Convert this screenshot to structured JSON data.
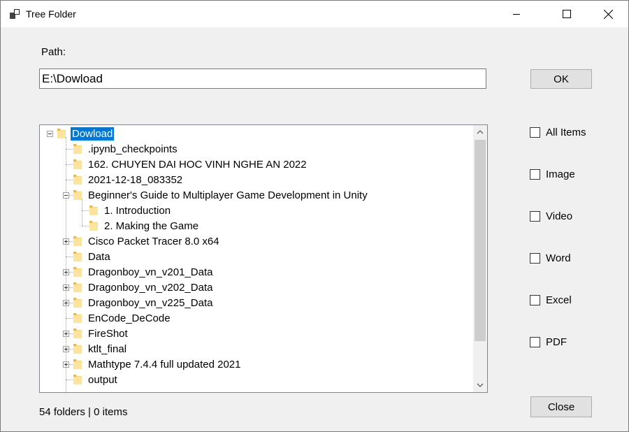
{
  "window": {
    "title": "Tree Folder",
    "controls": [
      "minimize-icon",
      "maximize-icon",
      "close-icon"
    ]
  },
  "path": {
    "label": "Path:",
    "value": "E:\\Dowload"
  },
  "buttons": {
    "ok": "OK",
    "close": "Close"
  },
  "tree": {
    "root": "Dowload",
    "root_selected": true,
    "nodes": [
      {
        "label": ".ipynb_checkpoints",
        "level": 1,
        "expander": "none"
      },
      {
        "label": "162. CHUYEN DAI HOC VINH NGHE AN 2022",
        "level": 1,
        "expander": "none"
      },
      {
        "label": "2021-12-18_083352",
        "level": 1,
        "expander": "none"
      },
      {
        "label": "Beginner's Guide to Multiplayer Game Development in Unity",
        "level": 1,
        "expander": "minus"
      },
      {
        "label": "1. Introduction",
        "level": 2,
        "expander": "none"
      },
      {
        "label": "2. Making the Game",
        "level": 2,
        "expander": "none"
      },
      {
        "label": "Cisco Packet Tracer 8.0 x64",
        "level": 1,
        "expander": "plus"
      },
      {
        "label": "Data",
        "level": 1,
        "expander": "none"
      },
      {
        "label": "Dragonboy_vn_v201_Data",
        "level": 1,
        "expander": "plus"
      },
      {
        "label": "Dragonboy_vn_v202_Data",
        "level": 1,
        "expander": "plus"
      },
      {
        "label": "Dragonboy_vn_v225_Data",
        "level": 1,
        "expander": "plus"
      },
      {
        "label": "EnCode_DeCode",
        "level": 1,
        "expander": "none"
      },
      {
        "label": "FireShot",
        "level": 1,
        "expander": "plus"
      },
      {
        "label": "ktlt_final",
        "level": 1,
        "expander": "plus"
      },
      {
        "label": "Mathtype 7.4.4 full updated 2021",
        "level": 1,
        "expander": "plus"
      },
      {
        "label": "output",
        "level": 1,
        "expander": "none"
      }
    ]
  },
  "filters": [
    {
      "label": "All Items",
      "checked": false
    },
    {
      "label": "Image",
      "checked": false
    },
    {
      "label": "Video",
      "checked": false
    },
    {
      "label": "Word",
      "checked": false
    },
    {
      "label": "Excel",
      "checked": false
    },
    {
      "label": "PDF",
      "checked": false
    }
  ],
  "status": "54 folders | 0 items",
  "colors": {
    "selection": "#0078d7",
    "folder": "#f8d775",
    "window_bg": "#f0f0f0"
  }
}
